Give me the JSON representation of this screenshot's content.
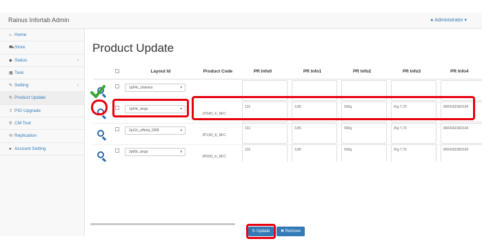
{
  "app": {
    "title": "Rainus Infortab Admin",
    "user": "Administrator"
  },
  "sidebar": {
    "items": [
      {
        "label": "Home",
        "icon": "home-icon",
        "glyph": "⌂",
        "arrow": ""
      },
      {
        "label": "Store",
        "icon": "cart-icon",
        "glyph": "⛟",
        "arrow": ""
      },
      {
        "label": "Status",
        "icon": "tag-icon",
        "glyph": "◆",
        "arrow": "‹"
      },
      {
        "label": "Task",
        "icon": "table-icon",
        "glyph": "▦",
        "arrow": ""
      },
      {
        "label": "Setting",
        "icon": "wrench-icon",
        "glyph": "✎",
        "arrow": "‹"
      },
      {
        "label": "Product Update",
        "icon": "refresh-icon",
        "glyph": "↻",
        "arrow": ""
      },
      {
        "label": "PIG Upgrade",
        "icon": "upload-icon",
        "glyph": "⇪",
        "arrow": ""
      },
      {
        "label": "CM Tool",
        "icon": "search-icon",
        "glyph": "⚲",
        "arrow": ""
      },
      {
        "label": "Replication",
        "icon": "replication-icon",
        "glyph": "⟲",
        "arrow": ""
      },
      {
        "label": "Account Setting",
        "icon": "user-icon",
        "glyph": "●",
        "arrow": ""
      }
    ]
  },
  "page": {
    "title": "Product Update"
  },
  "table": {
    "headers": [
      "Layout Id",
      "Product Code",
      "PR Info0",
      "PR Info1",
      "PR Info2",
      "PR Info3",
      "PR Info4"
    ],
    "rows": [
      {
        "layout": "1p54c_classica",
        "code": "",
        "info": [
          "",
          "",
          "",
          "",
          ""
        ]
      },
      {
        "layout": "1p54c_largo",
        "code": "1P54D_K_NFC",
        "info": [
          "131",
          "3,85",
          "500g",
          "/Kg 7,70",
          "8004182360104"
        ]
      },
      {
        "layout": "2p12c_offerta_DKB",
        "code": "2P13D_K_NFC",
        "info": [
          "131",
          "3,85",
          "500g",
          "/Kg 7,70",
          "8004182360104"
        ]
      },
      {
        "layout": "2p00c_largo",
        "code": "2P00D_K_NFC",
        "info": [
          "131",
          "3,85",
          "500g",
          "/Kg 7,70",
          "8004182360104"
        ]
      }
    ]
  },
  "buttons": {
    "update": "Update",
    "remove": "Remove"
  },
  "colors": {
    "highlight": "#e8000d",
    "primary": "#337ab7",
    "check": "#3aa335"
  }
}
